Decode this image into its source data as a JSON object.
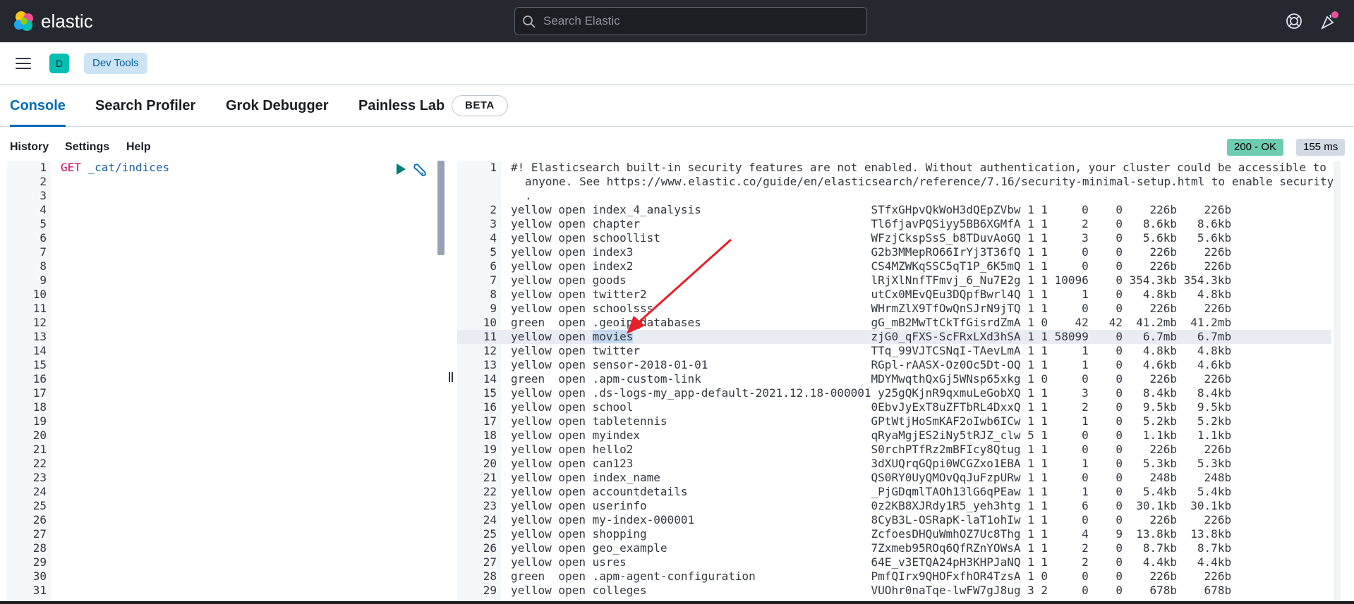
{
  "header": {
    "logo_text": "elastic",
    "search_placeholder": "Search Elastic",
    "help_icon": "help-icon",
    "news_icon": "newsfeed-icon"
  },
  "nav": {
    "space_letter": "D",
    "breadcrumb": "Dev Tools"
  },
  "tabs": [
    {
      "label": "Console",
      "active": true
    },
    {
      "label": "Search Profiler",
      "active": false
    },
    {
      "label": "Grok Debugger",
      "active": false
    },
    {
      "label": "Painless Lab",
      "active": false
    }
  ],
  "beta_badge": "BETA",
  "toolbar": {
    "history": "History",
    "settings": "Settings",
    "help": "Help",
    "status": "200 - OK",
    "time": "155 ms"
  },
  "request": {
    "method": "GET",
    "path": "_cat/indices",
    "line_count": 31
  },
  "response": {
    "first_line": "#! Elasticsearch built-in security features are not enabled. Without authentication, your cluster could be accessible to",
    "first_line_wrap_1": "anyone. See https://www.elastic.co/guide/en/elasticsearch/reference/7.16/security-minimal-setup.html to enable security",
    "first_line_wrap_2": ".",
    "highlighted_line": 11,
    "selected_word": "movies",
    "rows": [
      {
        "n": 2,
        "text": "yellow open index_4_analysis                         STfxGHpvQkWoH3dQEpZVbw 1 1     0    0    226b    226b"
      },
      {
        "n": 3,
        "text": "yellow open chapter                                  Tl6fjavPQSiyy5BB6XGMfA 1 1     2    0   8.6kb   8.6kb"
      },
      {
        "n": 4,
        "text": "yellow open schoollist                               WFzjCkspSsS_b8TDuvAoGQ 1 1     3    0   5.6kb   5.6kb"
      },
      {
        "n": 5,
        "text": "yellow open index3                                   G2b3MMepRO66IrYj3T36fQ 1 1     0    0    226b    226b"
      },
      {
        "n": 6,
        "text": "yellow open index2                                   CS4MZWKqSSC5qT1P_6K5mQ 1 1     0    0    226b    226b"
      },
      {
        "n": 7,
        "text": "yellow open goods                                    lRjXlNnfTFmvj_6_Nu7E2g 1 1 10096    0 354.3kb 354.3kb"
      },
      {
        "n": 8,
        "text": "yellow open twitter2                                 utCx0MEvQEu3DQpfBwrl4Q 1 1     1    0   4.8kb   4.8kb"
      },
      {
        "n": 9,
        "text": "yellow open schoolsss                                WHrmZlX9TfOwQnSJrN9jTQ 1 1     0    0    226b    226b"
      },
      {
        "n": 10,
        "text": "green  open .geoip_databases                         gG_mB2MwTtCkTfGisrdZmA 1 0    42   42  41.2mb  41.2mb"
      },
      {
        "n": 11,
        "text": "yellow open movies                                   zjG0_qFXS-ScFRxLXd3hSA 1 1 58099    0   6.7mb   6.7mb"
      },
      {
        "n": 12,
        "text": "yellow open twitter                                  TTq_99VJTCSNqI-TAevLmA 1 1     1    0   4.8kb   4.8kb"
      },
      {
        "n": 13,
        "text": "yellow open sensor-2018-01-01                        RGpl-rAASX-Oz0Oc5Dt-OQ 1 1     1    0   4.6kb   4.6kb"
      },
      {
        "n": 14,
        "text": "green  open .apm-custom-link                         MDYMwqthQxGj5WNsp65xkg 1 0     0    0    226b    226b"
      },
      {
        "n": 15,
        "text": "yellow open .ds-logs-my_app-default-2021.12.18-000001 y25gQKjnR9qxmuLeGobXQ 1 1     3    0   8.4kb   8.4kb"
      },
      {
        "n": 16,
        "text": "yellow open school                                   0EbvJyExT8uZFTbRL4DxxQ 1 1     2    0   9.5kb   9.5kb"
      },
      {
        "n": 17,
        "text": "yellow open tabletennis                              GPtWtjHoSmKAF2oIwb6ICw 1 1     1    0   5.2kb   5.2kb"
      },
      {
        "n": 18,
        "text": "yellow open myindex                                  qRyaMgjES2iNy5tRJZ_clw 5 1     0    0   1.1kb   1.1kb"
      },
      {
        "n": 19,
        "text": "yellow open hello2                                   S0rchPTfRz2mBFIcy8Qtug 1 1     0    0    226b    226b"
      },
      {
        "n": 20,
        "text": "yellow open can123                                   3dXUQrqGQpi0WCGZxo1EBA 1 1     1    0   5.3kb   5.3kb"
      },
      {
        "n": 21,
        "text": "yellow open index_name                               QS0RY0UyQMOvQqJuFzpURw 1 1     0    0    248b    248b"
      },
      {
        "n": 22,
        "text": "yellow open accountdetails                           _PjGDqmlTAOh13lG6qPEaw 1 1     1    0   5.4kb   5.4kb"
      },
      {
        "n": 23,
        "text": "yellow open userinfo                                 0z2KB8XJRdy1R5_yeh3htg 1 1     6    0  30.1kb  30.1kb"
      },
      {
        "n": 24,
        "text": "yellow open my-index-000001                          8CyB3L-OSRapK-laT1ohIw 1 1     0    0    226b    226b"
      },
      {
        "n": 25,
        "text": "yellow open shopping                                 ZcfoesDHQuWmhOZ7Uc8Thg 1 1     4    9  13.8kb  13.8kb"
      },
      {
        "n": 26,
        "text": "yellow open geo_example                              7Zxmeb95ROq6QfRZnYOWsA 1 1     2    0   8.7kb   8.7kb"
      },
      {
        "n": 27,
        "text": "yellow open usres                                    64E_v3ETQA24pH3KHPJaNQ 1 1     2    0   4.4kb   4.4kb"
      },
      {
        "n": 28,
        "text": "green  open .apm-agent-configuration                 PmfQIrx9QHOFxfhOR4TzsA 1 0     0    0    226b    226b"
      },
      {
        "n": 29,
        "text": "yellow open colleges                                 VUOhr0naTqe-lwFW7gJ8ug 3 2     0    0    678b    678b"
      }
    ]
  },
  "colors": {
    "header_bg": "#25282f",
    "accent": "#006bb8",
    "status_ok": "#6dccb1"
  }
}
